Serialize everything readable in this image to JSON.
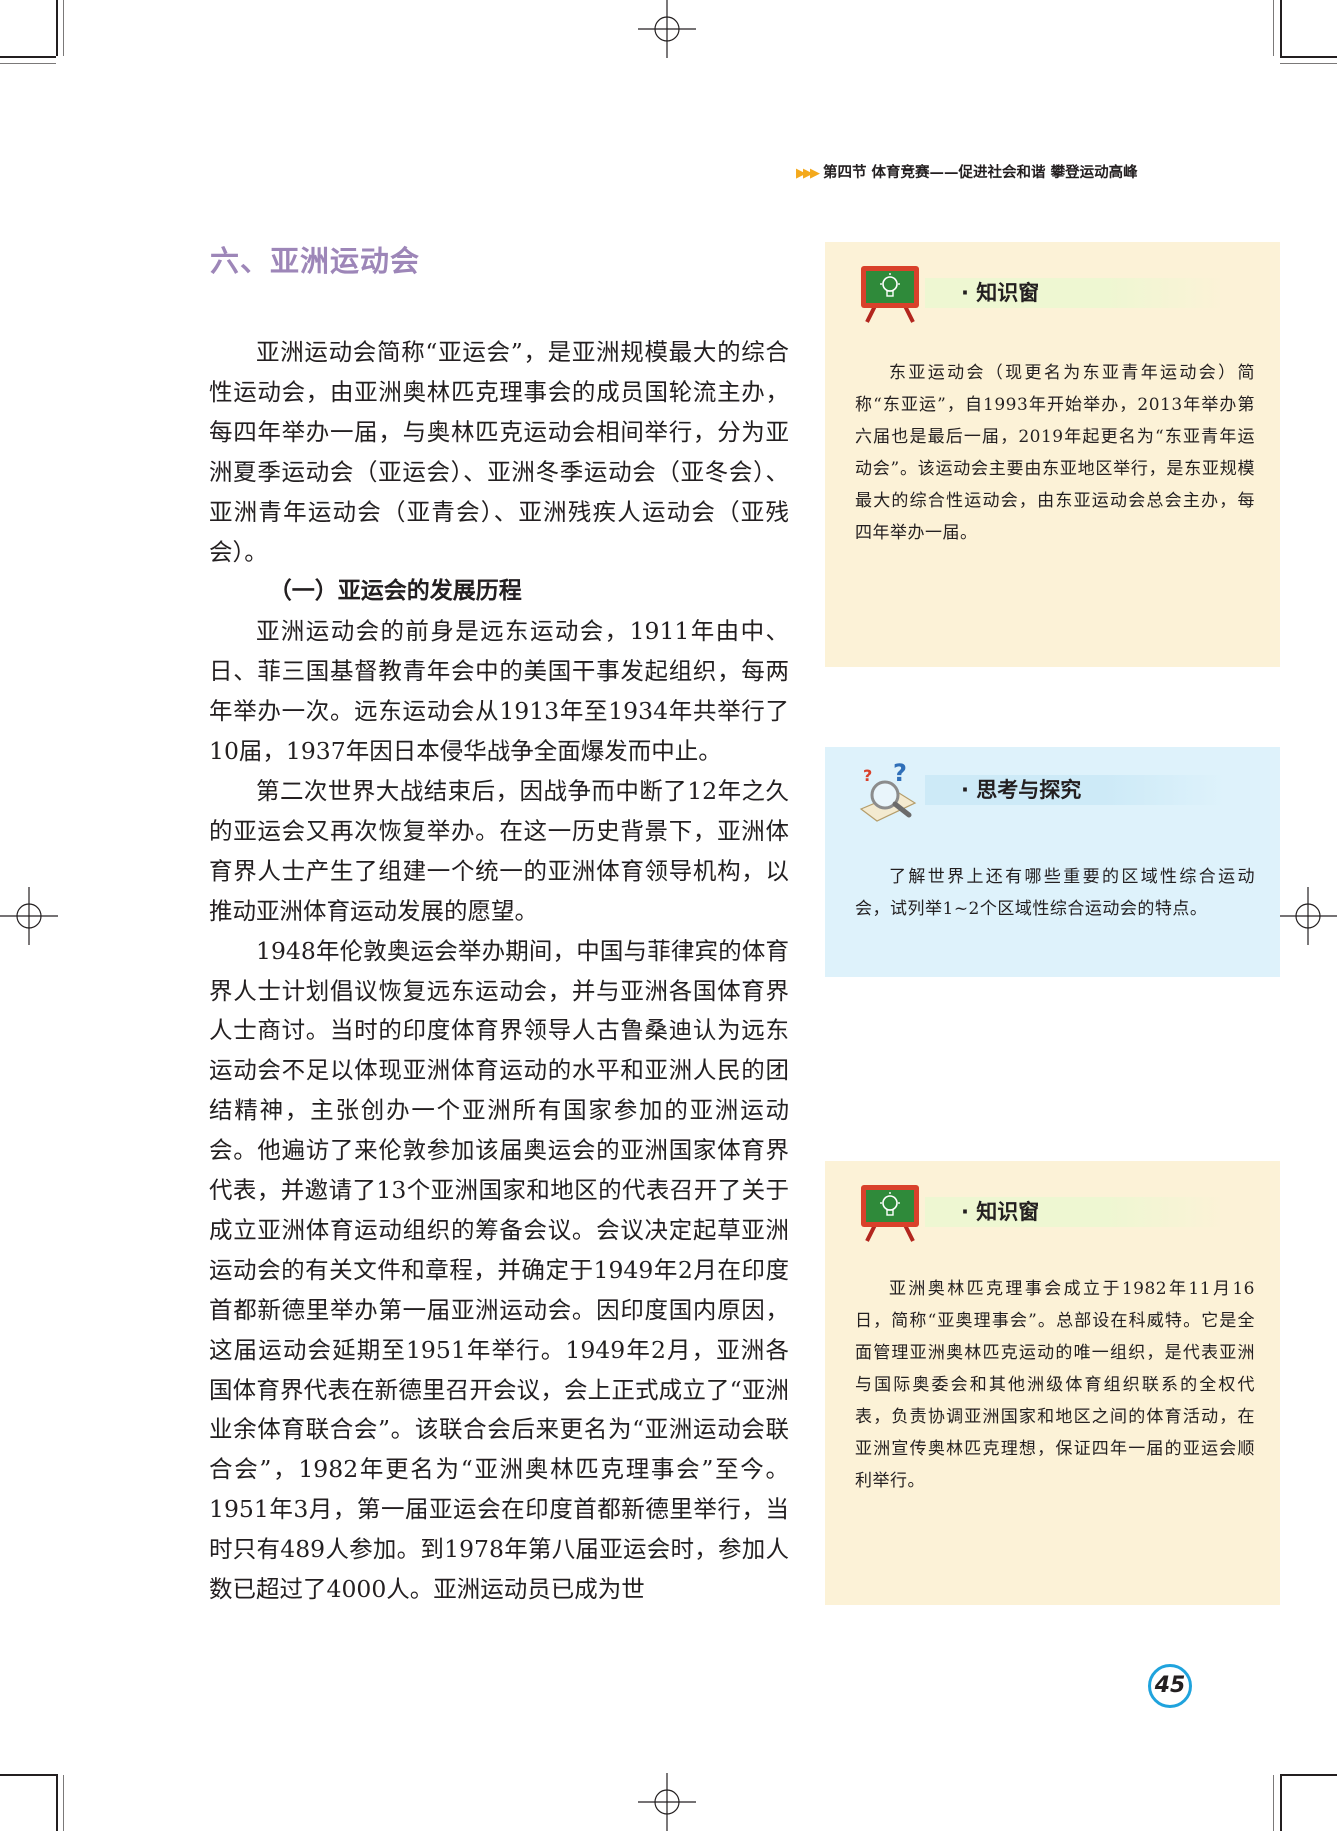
{
  "header": {
    "arrows": "▶▶▶",
    "text": "第四节   体育竞赛——促进社会和谐 攀登运动高峰"
  },
  "section": {
    "title": "六、亚洲运动会"
  },
  "body": {
    "p1": "亚洲运动会简称“亚运会”，是亚洲规模最大的综合性运动会，由亚洲奥林匹克理事会的成员国轮流主办，每四年举办一届，与奥林匹克运动会相间举行，分为亚洲夏季运动会（亚运会）、亚洲冬季运动会（亚冬会）、亚洲青年运动会（亚青会）、亚洲残疾人运动会（亚残会）。",
    "subtitle": "（一）亚运会的发展历程",
    "p2": "亚洲运动会的前身是远东运动会，1911年由中、日、菲三国基督教青年会中的美国干事发起组织，每两年举办一次。远东运动会从1913年至1934年共举行了10届，1937年因日本侵华战争全面爆发而中止。",
    "p3": "第二次世界大战结束后，因战争而中断了12年之久的亚运会又再次恢复举办。在这一历史背景下，亚洲体育界人士产生了组建一个统一的亚洲体育领导机构，以推动亚洲体育运动发展的愿望。",
    "p4": "1948年伦敦奥运会举办期间，中国与菲律宾的体育界人士计划倡议恢复远东运动会，并与亚洲各国体育界人士商讨。当时的印度体育界领导人古鲁桑迪认为远东运动会不足以体现亚洲体育运动的水平和亚洲人民的团结精神，主张创办一个亚洲所有国家参加的亚洲运动会。他遍访了来伦敦参加该届奥运会的亚洲国家体育界代表，并邀请了13个亚洲国家和地区的代表召开了关于成立亚洲体育运动组织的筹备会议。会议决定起草亚洲运动会的有关文件和章程，并确定于1949年2月在印度首都新德里举办第一届亚洲运动会。因印度国内原因，这届运动会延期至1951年举行。1949年2月，亚洲各国体育界代表在新德里召开会议，会上正式成立了“亚洲业余体育联合会”。该联合会后来更名为“亚洲运动会联合会”，1982年更名为“亚洲奥林匹克理事会”至今。1951年3月，第一届亚运会在印度首都新德里举行，当时只有489人参加。到1978年第八届亚运会时，参加人数已超过了4000人。亚洲运动员已成为世"
  },
  "sidebar": {
    "box1": {
      "title": "· 知识窗",
      "icon": "chalkboard-lightbulb-icon",
      "text": "东亚运动会（现更名为东亚青年运动会）简称“东亚运”，自1993年开始举办，2013年举办第六届也是最后一届，2019年起更名为“东亚青年运动会”。该运动会主要由东亚地区举行，是东亚规模最大的综合性运动会，由东亚运动会总会主办，每四年举办一届。"
    },
    "box2": {
      "title": "· 思考与探究",
      "icon": "magnifier-question-icon",
      "text": "了解世界上还有哪些重要的区域性综合运动会，试列举1~2个区域性综合运动会的特点。"
    },
    "box3": {
      "title": "· 知识窗",
      "icon": "chalkboard-lightbulb-icon",
      "text": "亚洲奥林匹克理事会成立于1982年11月16日，简称“亚奥理事会”。总部设在科威特。它是全面管理亚洲奥林匹克运动的唯一组织，是代表亚洲与国际奥委会和其他洲级体育组织联系的全权代表，负责协调亚洲国家和地区之间的体育活动，在亚洲宣传奥林匹克理想，保证四年一届的亚运会顺利举行。"
    }
  },
  "page_number": "45",
  "colors": {
    "title": "#9d86b8",
    "cream_box": "#fcf2d7",
    "blue_box": "#def2fb",
    "page_ring": "#1fa3dd",
    "arrows": "#f4a91c"
  }
}
